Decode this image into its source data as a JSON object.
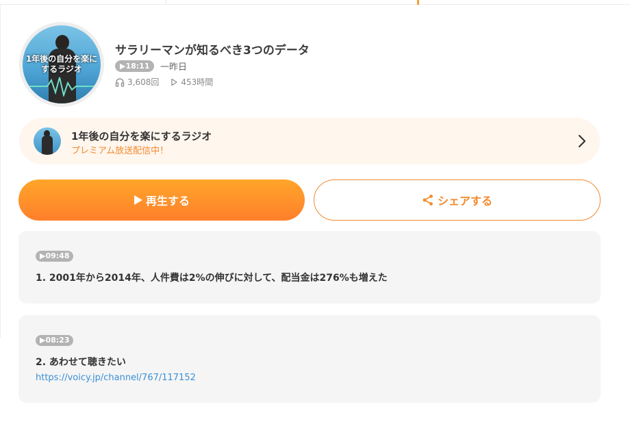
{
  "episode": {
    "title": "サラリーマンが知るべき3つのデータ",
    "duration": "▶18:11",
    "date": "一昨日",
    "plays": "3,608回",
    "listen_time": "453時間",
    "artwork_text": "1年後の自分を楽にするラジオ"
  },
  "channel": {
    "name": "1年後の自分を楽にするラジオ",
    "status": "プレミアム放送配信中！"
  },
  "actions": {
    "play_label": "再生する",
    "share_label": "シェアする"
  },
  "chapters": [
    {
      "time": "▶09:48",
      "text": "1.  2001年から2014年、人件費は2%の伸びに対して、配当金は276%も増えた"
    },
    {
      "time": "▶08:23",
      "text": "2.  あわせて聴きたい",
      "link": "https://voicy.jp/channel/767/117152"
    }
  ],
  "colors": {
    "accent": "#f28a2e",
    "play_gradient_top": "#ffa62a",
    "play_gradient_bottom": "#ff7f2a",
    "badge": "#b3b3b3",
    "link": "#3a8fd6",
    "card_bg": "#f5f5f5",
    "channel_bg": "#fff6ee"
  },
  "icons": {
    "plays": "headphones-icon",
    "listen_time": "play-outline-icon",
    "chevron": "chevron-right-icon",
    "play": "play-icon",
    "share": "share-icon"
  }
}
